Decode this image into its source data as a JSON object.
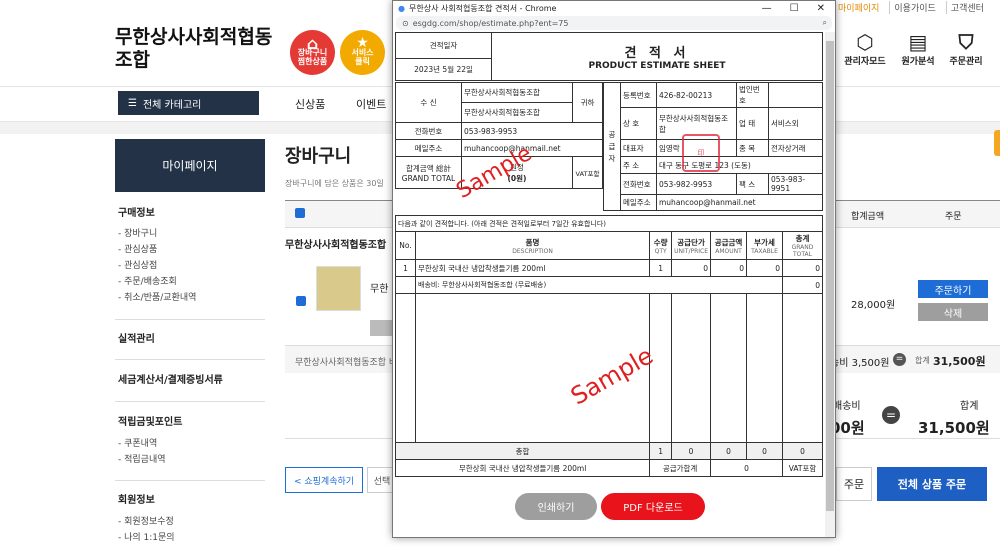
{
  "util_links": [
    "마이페이지",
    "이용가이드",
    "고객센터"
  ],
  "site": {
    "logo": "무한상사사회적협동조합",
    "badges": [
      {
        "label": "장바구니\n찜한상품",
        "color": "#e53935",
        "glyph": "⌂"
      },
      {
        "label": "서비스\n클릭",
        "color": "#f2a900",
        "glyph": "★"
      }
    ],
    "header_icons": [
      {
        "label": "관리자모드",
        "icon": "cube-icon",
        "glyph": "⬡"
      },
      {
        "label": "원가분석",
        "icon": "receipt-icon",
        "glyph": "▤"
      },
      {
        "label": "주문관리",
        "icon": "basket-icon",
        "glyph": "⛉"
      }
    ]
  },
  "nav": {
    "category_button": "전체 카테고리",
    "items": [
      "신상품",
      "이벤트"
    ]
  },
  "sidebar": {
    "title": "마이페이지",
    "groups": [
      {
        "title": "구매정보",
        "items": [
          "- 장바구니",
          "- 관심상품",
          "- 관심상점",
          "- 주문/배송조회",
          "- 취소/반품/교환내역"
        ]
      },
      {
        "title": "실적관리",
        "items": []
      },
      {
        "title": "세금계산서/결제증빙서류",
        "items": []
      },
      {
        "title": "적립금및포인트",
        "items": [
          "- 쿠폰내역",
          "- 적립금내역"
        ]
      },
      {
        "title": "회원정보",
        "items": [
          "- 회원정보수정",
          "- 나의 1:1문의"
        ]
      }
    ]
  },
  "cart": {
    "title": "장바구니",
    "subtitle": "장바구니에 담은 상품은 30일",
    "col_total": "합계금액",
    "col_order": "주문",
    "store": "무한상사사회적협동조합",
    "item_name": "무한",
    "item_total": "28,000원",
    "order_button": "주문하기",
    "delete_button": "삭제",
    "strip_store": "무한상사사회적협동조합 배",
    "shipping_small": "송비 3,500원",
    "total_small_label": "합계",
    "total_small": "31,500원",
    "shipping_label": "배송비",
    "shipping_big": "00원",
    "total_label": "합계",
    "total_big": "31,500원",
    "continue_button": "< 쇼핑계속하기",
    "select_button": "선택",
    "order_sel_button": "주문",
    "order_all_button": "전체 상품 주문"
  },
  "popup": {
    "window_title": "무한상사 사회적협동조합 견적서 - Chrome",
    "url": "esgdg.com/shop/estimate.php?ent=75",
    "doc": {
      "date_label": "견적일자",
      "date": "2023년  5월  22일",
      "title": "견 적 서",
      "title_en": "PRODUCT ESTIMATE SHEET",
      "recipient_label": "수    신",
      "recipient1": "무한상사사회적협동조합",
      "recipient2": "무한상사사회적협동조합",
      "honorific": "귀하",
      "phone_label": "전화번호",
      "phone": "053-983-9953",
      "email_label": "메일주소",
      "email": "muhancoop@hanmail.net",
      "total_label": "합계금액 総計",
      "total_label_en": "GRAND TOTAL",
      "total_won": "원정",
      "total_value": "(0원)",
      "vat": "VAT포함",
      "supplier_label": "공\n급\n자",
      "reg_label": "등록번호",
      "reg": "426-82-00213",
      "corp_label": "법인번호",
      "company_label": "상    호",
      "company": "무한상사사회적협동조합",
      "biz_label": "업    태",
      "biz": "서비스외",
      "ceo_label": "대표자",
      "ceo": "임영락",
      "type_label": "종    목",
      "type": "전자상거래",
      "addr_label": "주    소",
      "addr": "대구 동구 도평로 123 (도동)",
      "tel_label": "전화번호",
      "tel": "053-982-9953",
      "fax_label": "팩    스",
      "fax": "053-983-9951",
      "mail_label": "메일주소",
      "mail": "muhancoop@hanmail.net",
      "notice": "다음과 같이 견적합니다. (아래 견적은 견적일로부터 7일간 유효합니다)",
      "cols": [
        {
          "ko": "No.",
          "en": ""
        },
        {
          "ko": "품명",
          "en": "DESCRIPTION"
        },
        {
          "ko": "수량",
          "en": "QTY"
        },
        {
          "ko": "공급단가",
          "en": "UNIT/PRICE"
        },
        {
          "ko": "공급금액",
          "en": "AMOUNT"
        },
        {
          "ko": "부가세",
          "en": "TAXABLE"
        },
        {
          "ko": "총계",
          "en": "GRAND TOTAL"
        }
      ],
      "rows": [
        [
          "1",
          "무한상회 국내산 냉압착생들기름 200ml",
          "1",
          "0",
          "0",
          "0",
          "0"
        ]
      ],
      "shipping_row": "배송비: 무한상사사회적협동조합 (무료배송)",
      "shipping_value": "0",
      "sum_label": "총합",
      "sums": [
        "1",
        "0",
        "0",
        "0",
        "0"
      ],
      "footer_item": "무한상회 국내산 냉압착생들기름 200ml",
      "footer_supply_label": "공급가합계",
      "footer_supply": "0",
      "footer_vat": "VAT포함",
      "stamp": "印",
      "sample": "Sample"
    },
    "print_button": "인쇄하기",
    "pdf_button": "PDF 다운로드",
    "colors": {
      "print": "#9e9e9e",
      "pdf": "#e8131b"
    }
  }
}
